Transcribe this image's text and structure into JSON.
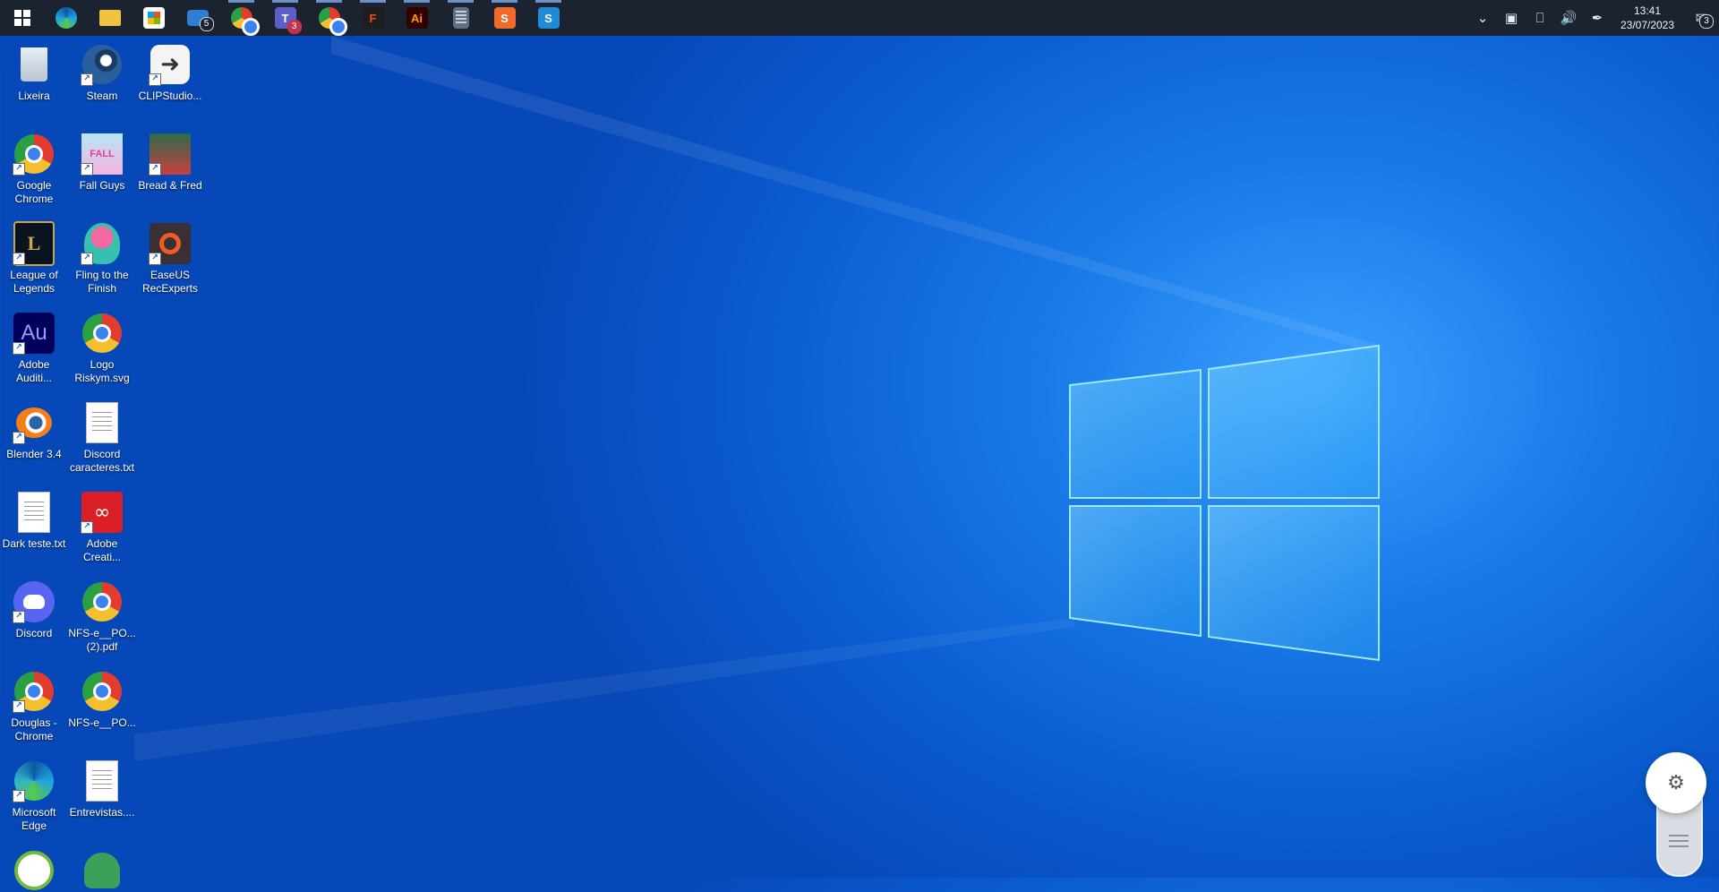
{
  "taskbar": {
    "apps": [
      {
        "name": "start-button",
        "label": "",
        "color": "#ffffff"
      },
      {
        "name": "edge-taskbar-icon",
        "label": "",
        "color": "#1fa3e0"
      },
      {
        "name": "file-explorer-icon",
        "label": "",
        "color": "#f3c33d"
      },
      {
        "name": "microsoft-store-icon",
        "label": "",
        "color": "#3a86d8"
      },
      {
        "name": "mail-icon",
        "label": "",
        "color": "#2d7fd4",
        "badge": "5"
      },
      {
        "name": "chrome-profile-icon",
        "label": "",
        "color": "#e33b2e"
      },
      {
        "name": "teams-icon",
        "label": "T",
        "color": "#5b5fc7",
        "badge": "3"
      },
      {
        "name": "chrome-icon",
        "label": "",
        "color": "#2c9f45"
      },
      {
        "name": "figma-icon",
        "label": "F",
        "color": "#1e1e1e"
      },
      {
        "name": "illustrator-icon",
        "label": "Ai",
        "color": "#330000"
      },
      {
        "name": "calculator-icon",
        "label": "",
        "color": "#607080"
      },
      {
        "name": "sublime-icon",
        "label": "S",
        "color": "#f06a2c"
      },
      {
        "name": "s-app-icon",
        "label": "S",
        "color": "#1f8ad8"
      }
    ],
    "clock": {
      "time": "13:41",
      "date": "23/07/2023"
    },
    "notifications_badge": "3"
  },
  "desktop": {
    "icons": [
      {
        "name": "recycle-bin",
        "label": "Lixeira",
        "kind": "bin"
      },
      {
        "name": "steam",
        "label": "Steam",
        "kind": "steam"
      },
      {
        "name": "clip-studio",
        "label": "CLIPStudio...",
        "kind": "clip"
      },
      {
        "name": "google-chrome",
        "label": "Google Chrome",
        "kind": "chrome"
      },
      {
        "name": "fall-guys",
        "label": "Fall Guys",
        "kind": "fallguys"
      },
      {
        "name": "bread-and-fred",
        "label": "Bread & Fred",
        "kind": "bread"
      },
      {
        "name": "league-of-legends",
        "label": "League of Legends",
        "kind": "lol"
      },
      {
        "name": "fling-to-the-finish",
        "label": "Fling to the Finish",
        "kind": "fling"
      },
      {
        "name": "easeus-recexperts",
        "label": "EaseUS RecExperts",
        "kind": "easeus"
      },
      {
        "name": "adobe-audition",
        "label": "Adobe Auditi...",
        "kind": "au"
      },
      {
        "name": "logo-riskym",
        "label": "Logo Riskym.svg",
        "kind": "chrome"
      },
      {
        "name": "blender",
        "label": "Blender 3.4",
        "kind": "blender"
      },
      {
        "name": "discord-caracteres",
        "label": "Discord caracteres.txt",
        "kind": "doc"
      },
      {
        "name": "dark-teste",
        "label": "Dark teste.txt",
        "kind": "doc"
      },
      {
        "name": "adobe-creative-cloud",
        "label": "Adobe Creati...",
        "kind": "cc"
      },
      {
        "name": "discord",
        "label": "Discord",
        "kind": "discord"
      },
      {
        "name": "nfs-pdf-2",
        "label": "NFS-e__PO... (2).pdf",
        "kind": "chrome"
      },
      {
        "name": "douglas-chrome",
        "label": "Douglas - Chrome",
        "kind": "chrome"
      },
      {
        "name": "nfs-pdf",
        "label": "NFS-e__PO...",
        "kind": "chrome"
      },
      {
        "name": "microsoft-edge",
        "label": "Microsoft Edge",
        "kind": "edge"
      },
      {
        "name": "entrevistas",
        "label": "Entrevistas....",
        "kind": "doc"
      }
    ]
  }
}
